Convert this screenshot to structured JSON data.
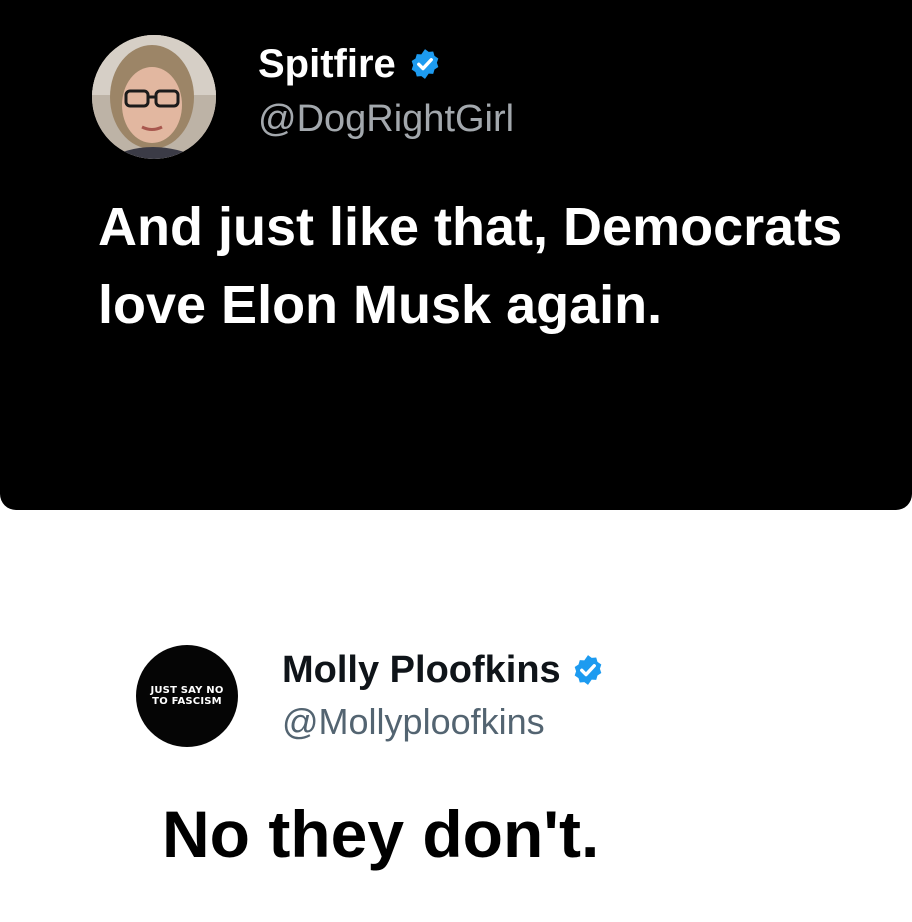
{
  "tweets": [
    {
      "display_name": "Spitfire",
      "handle": "@DogRightGirl",
      "verified": true,
      "avatar_icon": "profile-photo-woman-glasses",
      "text": "And just like that, Democrats love Elon Musk again.",
      "theme": "dark"
    },
    {
      "display_name": "Molly Ploofkins",
      "handle": "@Mollyploofkins",
      "verified": true,
      "avatar_icon": "text-avatar",
      "avatar_text_line1": "JUST SAY NO",
      "avatar_text_line2": "TO FASCISM",
      "text": "No they don't.",
      "theme": "light"
    }
  ],
  "colors": {
    "dark_background": "#000000",
    "verified_blue": "#1d9bf0",
    "dark_handle": "#a3a8ad",
    "light_handle": "#536471"
  }
}
